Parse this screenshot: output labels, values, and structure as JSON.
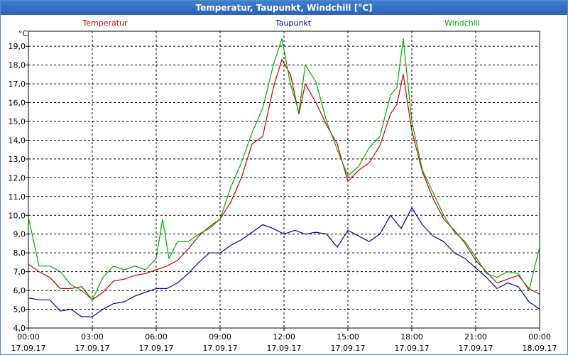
{
  "window_title": "Temperatur, Taupunkt, Windchill [°C]",
  "chart_data": {
    "type": "line",
    "title": "Temperatur, Taupunkt, Windchill [°C]",
    "ylabel": "°C",
    "ylim": [
      4.0,
      19.8
    ],
    "xlim": [
      0,
      24
    ],
    "grid": true,
    "legend_placement": "top",
    "y_ticks": [
      "4,0",
      "5,0",
      "6,0",
      "7,0",
      "8,0",
      "9,0",
      "10,0",
      "11,0",
      "12,0",
      "13,0",
      "14,0",
      "15,0",
      "16,0",
      "17,0",
      "18,0",
      "19,0"
    ],
    "y_tick_values": [
      4,
      5,
      6,
      7,
      8,
      9,
      10,
      11,
      12,
      13,
      14,
      15,
      16,
      17,
      18,
      19
    ],
    "x_ticks": [
      {
        "time": "00:00",
        "date": "17.09.17",
        "hour": 0
      },
      {
        "time": "03:00",
        "date": "17.09.17",
        "hour": 3
      },
      {
        "time": "06:00",
        "date": "17.09.17",
        "hour": 6
      },
      {
        "time": "09:00",
        "date": "17.09.17",
        "hour": 9
      },
      {
        "time": "12:00",
        "date": "17.09.17",
        "hour": 12
      },
      {
        "time": "15:00",
        "date": "17.09.17",
        "hour": 15
      },
      {
        "time": "18:00",
        "date": "17.09.17",
        "hour": 18
      },
      {
        "time": "21:00",
        "date": "17.09.17",
        "hour": 21
      },
      {
        "time": "00:00",
        "date": "18.09.17",
        "hour": 24
      }
    ],
    "series": [
      {
        "name": "Temperatur",
        "color": "#cc0000",
        "x": [
          0,
          0.5,
          1,
          1.5,
          2,
          2.5,
          3,
          3.5,
          4,
          4.5,
          5,
          5.5,
          6,
          6.5,
          7,
          7.5,
          8,
          8.5,
          9,
          9.5,
          10,
          10.5,
          11,
          11.5,
          11.9,
          12.3,
          12.7,
          13,
          13.5,
          14,
          14.5,
          15,
          15.5,
          16,
          16.5,
          17,
          17.3,
          17.6,
          18,
          18.5,
          19,
          19.5,
          20,
          20.5,
          21,
          21.5,
          22,
          22.5,
          23,
          23.5,
          24
        ],
        "y": [
          7.4,
          7.0,
          6.7,
          6.1,
          6.1,
          6.2,
          5.5,
          5.9,
          6.5,
          6.6,
          6.8,
          6.9,
          7.1,
          7.3,
          7.6,
          8.2,
          8.9,
          9.4,
          9.8,
          10.7,
          12.0,
          13.8,
          14.2,
          16.8,
          18.3,
          17.5,
          15.4,
          17.0,
          16.0,
          14.8,
          13.8,
          11.8,
          12.4,
          12.8,
          13.7,
          15.4,
          15.9,
          17.5,
          14.5,
          12.3,
          10.9,
          9.8,
          9.2,
          8.5,
          7.6,
          7.0,
          6.4,
          6.6,
          6.8,
          6.1,
          5.8
        ]
      },
      {
        "name": "Taupunkt",
        "color": "#0000aa",
        "x": [
          0,
          0.5,
          1,
          1.5,
          2,
          2.5,
          3,
          3.5,
          4,
          4.5,
          5,
          5.5,
          6,
          6.5,
          7,
          7.5,
          8,
          8.5,
          9,
          9.5,
          10,
          10.5,
          11,
          11.5,
          12,
          12.5,
          13,
          13.5,
          14,
          14.5,
          15,
          15.5,
          16,
          16.5,
          17,
          17.5,
          18,
          18.5,
          19,
          19.5,
          20,
          20.5,
          21,
          21.5,
          22,
          22.5,
          23,
          23.5,
          24
        ],
        "y": [
          5.6,
          5.5,
          5.5,
          4.9,
          5.0,
          4.6,
          4.6,
          5.0,
          5.3,
          5.4,
          5.7,
          5.9,
          6.1,
          6.1,
          6.4,
          6.9,
          7.5,
          8.0,
          8.0,
          8.4,
          8.7,
          9.1,
          9.5,
          9.3,
          9.0,
          9.2,
          9.0,
          9.1,
          9.0,
          8.3,
          9.2,
          8.9,
          8.6,
          9.0,
          10.0,
          9.3,
          10.4,
          9.5,
          8.9,
          8.6,
          8.0,
          7.7,
          7.2,
          6.7,
          6.1,
          6.4,
          6.2,
          5.4,
          5.0
        ]
      },
      {
        "name": "Windchill",
        "color": "#00aa00",
        "x": [
          0,
          0.5,
          1,
          1.5,
          2,
          2.5,
          3,
          3.5,
          4,
          4.5,
          5,
          5.5,
          6,
          6.3,
          6.6,
          7,
          7.5,
          8,
          8.5,
          9,
          9.5,
          10,
          10.5,
          11,
          11.5,
          11.9,
          12.3,
          12.7,
          13,
          13.5,
          14,
          14.5,
          15,
          15.5,
          16,
          16.5,
          17,
          17.3,
          17.6,
          18,
          18.5,
          19,
          19.5,
          20,
          20.5,
          21,
          21.5,
          22,
          22.5,
          23,
          23.5,
          24
        ],
        "y": [
          9.9,
          7.3,
          7.3,
          7.0,
          6.3,
          6.0,
          5.5,
          6.7,
          7.3,
          7.1,
          7.3,
          7.1,
          7.7,
          9.8,
          7.7,
          8.6,
          8.6,
          9.0,
          9.3,
          9.8,
          11.5,
          12.8,
          14.4,
          15.7,
          18.0,
          19.4,
          17.0,
          15.5,
          18.0,
          17.1,
          15.0,
          13.5,
          12.1,
          12.6,
          13.6,
          14.2,
          16.4,
          16.8,
          19.4,
          15.0,
          12.4,
          11.2,
          10.0,
          9.1,
          8.6,
          7.8,
          6.9,
          6.7,
          7.0,
          6.9,
          6.0,
          8.3
        ]
      }
    ]
  }
}
